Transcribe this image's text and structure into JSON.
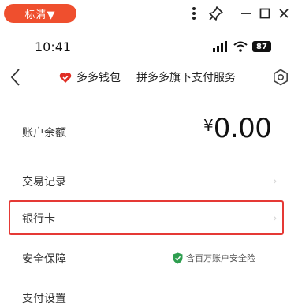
{
  "toolbar": {
    "quality_label": "标清▼"
  },
  "status_bar": {
    "time": "10:41",
    "battery": "87"
  },
  "nav": {
    "title": "多多钱包",
    "subtitle": "拼多多旗下支付服务"
  },
  "balance_row": {
    "label": "账户余额",
    "currency": "¥",
    "amount": "0.00"
  },
  "menu": {
    "transactions": "交易记录",
    "bank_card": "银行卡",
    "security": "安全保障",
    "security_note": "含百万账户安全险",
    "partial_item": "支付设置"
  },
  "colors": {
    "accent": "#ef4f2e",
    "highlight_border": "#e53935",
    "security_green": "#2e9e4f",
    "wallet_red": "#e02e24"
  }
}
